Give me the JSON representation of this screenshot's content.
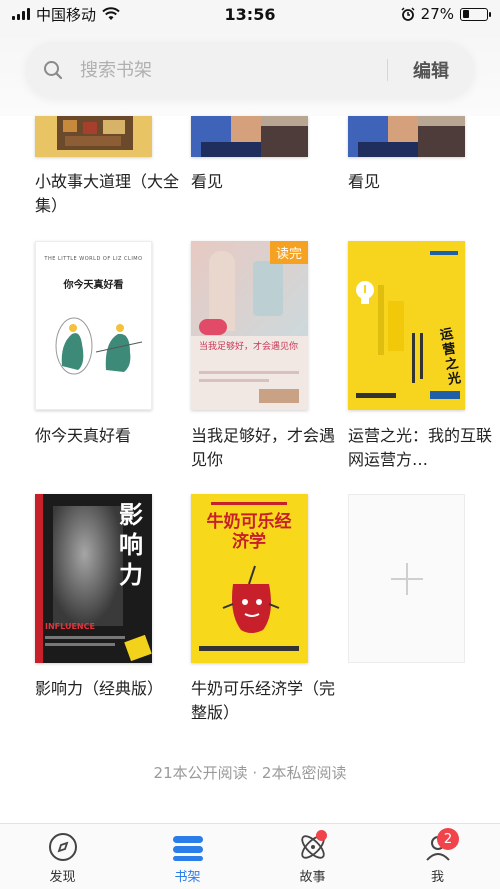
{
  "status_bar": {
    "carrier": "中国移动",
    "time": "13:56",
    "battery": "27%",
    "battery_level": 0.27
  },
  "search": {
    "placeholder": "搜索书架",
    "edit_label": "编辑"
  },
  "books": [
    {
      "title": "小故事大道理（大全集）"
    },
    {
      "title": "看见"
    },
    {
      "title": "看见"
    },
    {
      "title": "你今天真好看",
      "cover_top_text": "THE LITTLE WORLD OF LIZ CLIMO",
      "cover_title": "你今天真好看"
    },
    {
      "title": "当我足够好，才会遇见你",
      "badge": "读完",
      "cover_title": "当我足够好，才会遇见你"
    },
    {
      "title": "运营之光：我的互联网运营方…",
      "cover_title": "运营之光"
    },
    {
      "title": "影响力（经典版）",
      "cover_title": "影响力",
      "cover_sub": "INFLUENCE"
    },
    {
      "title": "牛奶可乐经济学（完整版）",
      "cover_title": "牛奶可乐经济学"
    }
  ],
  "footer_note": "21本公开阅读 · 2本私密阅读",
  "tabs": [
    {
      "label": "发现",
      "icon": "compass-icon"
    },
    {
      "label": "书架",
      "icon": "bookshelf-icon"
    },
    {
      "label": "故事",
      "icon": "atom-icon"
    },
    {
      "label": "我",
      "icon": "user-icon",
      "badge": "2"
    }
  ],
  "colors": {
    "accent": "#2b7de9",
    "badge_red": "#f0434a",
    "read_badge": "#f5a223"
  }
}
